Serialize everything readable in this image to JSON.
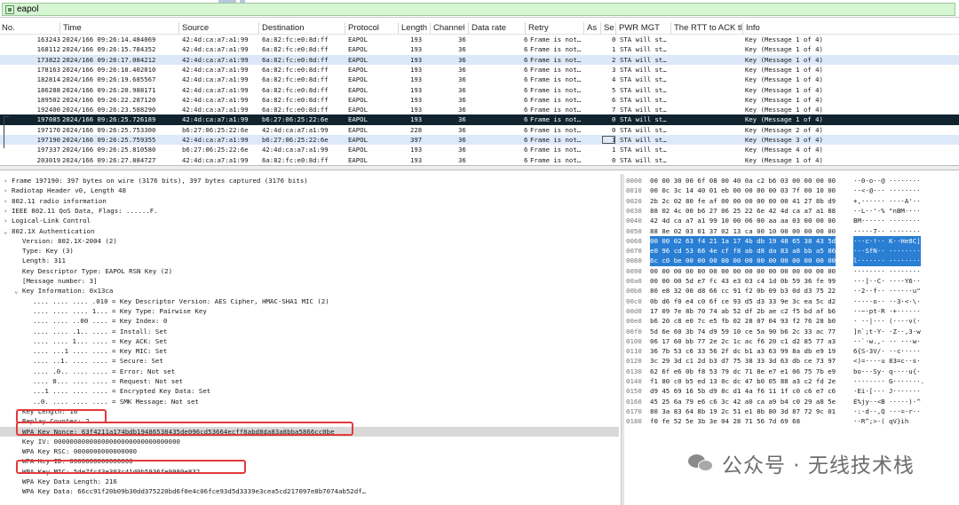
{
  "filter": {
    "value": "eapol"
  },
  "columns": [
    "No.",
    "Time",
    "Source",
    "Destination",
    "Protocol",
    "Length",
    "Channel",
    "Data rate",
    "Retry",
    "As",
    "Se",
    "PWR MGT",
    "The RTT to ACK tl",
    "Info"
  ],
  "packets": [
    {
      "no": "163243",
      "time": "2024/166 09:26:14.484069",
      "src": "42:4d:ca:a7:a1:99",
      "dst": "6a:82:fc:e0:8d:ff",
      "proto": "EAPOL",
      "len": "193",
      "ch": "36",
      "rate": "6",
      "retry": "Frame is not…",
      "se": "0",
      "pwr": "STA will st…",
      "info": "Key (Message 1 of 4)",
      "style": ""
    },
    {
      "no": "168112",
      "time": "2024/166 09:26:15.784352",
      "src": "42:4d:ca:a7:a1:99",
      "dst": "6a:82:fc:e0:8d:ff",
      "proto": "EAPOL",
      "len": "193",
      "ch": "36",
      "rate": "6",
      "retry": "Frame is not…",
      "se": "1",
      "pwr": "STA will st…",
      "info": "Key (Message 1 of 4)",
      "style": ""
    },
    {
      "no": "173822",
      "time": "2024/166 09:26:17.084212",
      "src": "42:4d:ca:a7:a1:99",
      "dst": "6a:82:fc:e0:8d:ff",
      "proto": "EAPOL",
      "len": "193",
      "ch": "36",
      "rate": "6",
      "retry": "Frame is not…",
      "se": "2",
      "pwr": "STA will st…",
      "info": "Key (Message 1 of 4)",
      "style": "alt"
    },
    {
      "no": "178163",
      "time": "2024/166 09:26:18.402010",
      "src": "42:4d:ca:a7:a1:99",
      "dst": "6a:82:fc:e0:8d:ff",
      "proto": "EAPOL",
      "len": "193",
      "ch": "36",
      "rate": "6",
      "retry": "Frame is not…",
      "se": "3",
      "pwr": "STA will st…",
      "info": "Key (Message 1 of 4)",
      "style": ""
    },
    {
      "no": "182814",
      "time": "2024/166 09:26:19.685567",
      "src": "42:4d:ca:a7:a1:99",
      "dst": "6a:82:fc:e0:8d:ff",
      "proto": "EAPOL",
      "len": "193",
      "ch": "36",
      "rate": "6",
      "retry": "Frame is not…",
      "se": "4",
      "pwr": "STA will st…",
      "info": "Key (Message 1 of 4)",
      "style": ""
    },
    {
      "no": "186288",
      "time": "2024/166 09:26:20.988171",
      "src": "42:4d:ca:a7:a1:99",
      "dst": "6a:82:fc:e0:8d:ff",
      "proto": "EAPOL",
      "len": "193",
      "ch": "36",
      "rate": "6",
      "retry": "Frame is not…",
      "se": "5",
      "pwr": "STA will st…",
      "info": "Key (Message 1 of 4)",
      "style": ""
    },
    {
      "no": "189502",
      "time": "2024/166 09:26:22.287120",
      "src": "42:4d:ca:a7:a1:99",
      "dst": "6a:82:fc:e0:8d:ff",
      "proto": "EAPOL",
      "len": "193",
      "ch": "36",
      "rate": "6",
      "retry": "Frame is not…",
      "se": "6",
      "pwr": "STA will st…",
      "info": "Key (Message 1 of 4)",
      "style": ""
    },
    {
      "no": "192400",
      "time": "2024/166 09:26:23.588290",
      "src": "42:4d:ca:a7:a1:99",
      "dst": "6a:82:fc:e0:8d:ff",
      "proto": "EAPOL",
      "len": "193",
      "ch": "36",
      "rate": "6",
      "retry": "Frame is not…",
      "se": "7",
      "pwr": "STA will st…",
      "info": "Key (Message 1 of 4)",
      "style": ""
    },
    {
      "no": "197085",
      "time": "2024/166 09:26:25.726189",
      "src": "42:4d:ca:a7:a1:99",
      "dst": "b6:27:06:25:22:6e",
      "proto": "EAPOL",
      "len": "193",
      "ch": "36",
      "rate": "6",
      "retry": "Frame is not…",
      "se": "0",
      "pwr": "STA will st…",
      "info": "Key (Message 1 of 4)",
      "style": "sel"
    },
    {
      "no": "197170",
      "time": "2024/166 09:26:25.753300",
      "src": "b6:27:06:25:22:6e",
      "dst": "42:4d:ca:a7:a1:99",
      "proto": "EAPOL",
      "len": "228",
      "ch": "36",
      "rate": "6",
      "retry": "Frame is not…",
      "se": "0",
      "pwr": "STA will st…",
      "info": "Key (Message 2 of 4)",
      "style": ""
    },
    {
      "no": "197190",
      "time": "2024/166 09:26:25.759355",
      "src": "42:4d:ca:a7:a1:99",
      "dst": "b6:27:06:25:22:6e",
      "proto": "EAPOL",
      "len": "397",
      "ch": "36",
      "rate": "6",
      "retry": "Frame is not…",
      "se": "1",
      "pwr": "STA will st…",
      "info": "Key (Message 3 of 4)",
      "style": "grp"
    },
    {
      "no": "197337",
      "time": "2024/166 09:26:25.810580",
      "src": "b6:27:06:25:22:6e",
      "dst": "42:4d:ca:a7:a1:99",
      "proto": "EAPOL",
      "len": "193",
      "ch": "36",
      "rate": "6",
      "retry": "Frame is not…",
      "se": "1",
      "pwr": "STA will st…",
      "info": "Key (Message 4 of 4)",
      "style": ""
    },
    {
      "no": "203019",
      "time": "2024/166 09:26:27.884727",
      "src": "42:4d:ca:a7:a1:99",
      "dst": "6a:82:fc:e0:8d:ff",
      "proto": "EAPOL",
      "len": "193",
      "ch": "36",
      "rate": "6",
      "retry": "Frame is not…",
      "se": "0",
      "pwr": "STA will st…",
      "info": "Key (Message 1 of 4)",
      "style": ""
    }
  ],
  "details": [
    {
      "t": ">",
      "text": "Frame 197190: 397 bytes on wire (3176 bits), 397 bytes captured (3176 bits)",
      "ind": 0
    },
    {
      "t": ">",
      "text": "Radiotap Header v0, Length 48",
      "ind": 0
    },
    {
      "t": ">",
      "text": "802.11 radio information",
      "ind": 0
    },
    {
      "t": ">",
      "text": "IEEE 802.11 QoS Data, Flags: ......F.",
      "ind": 0
    },
    {
      "t": ">",
      "text": "Logical-Link Control",
      "ind": 0
    },
    {
      "t": "v",
      "text": "802.1X Authentication",
      "ind": 0
    },
    {
      "t": "",
      "text": "Version: 802.1X-2004 (2)",
      "ind": 1
    },
    {
      "t": "",
      "text": "Type: Key (3)",
      "ind": 1
    },
    {
      "t": "",
      "text": "Length: 311",
      "ind": 1
    },
    {
      "t": "",
      "text": "Key Descriptor Type: EAPOL RSN Key (2)",
      "ind": 1
    },
    {
      "t": "",
      "text": "[Message number: 3]",
      "ind": 1
    },
    {
      "t": "v",
      "text": "Key Information: 0x13ca",
      "ind": 1
    },
    {
      "t": "",
      "text": ".... .... .... .010 = Key Descriptor Version: AES Cipher, HMAC-SHA1 MIC (2)",
      "ind": 2
    },
    {
      "t": "",
      "text": ".... .... .... 1... = Key Type: Pairwise Key",
      "ind": 2
    },
    {
      "t": "",
      "text": ".... .... ..00 .... = Key Index: 0",
      "ind": 2
    },
    {
      "t": "",
      "text": ".... .... .1.. .... = Install: Set",
      "ind": 2
    },
    {
      "t": "",
      "text": ".... .... 1... .... = Key ACK: Set",
      "ind": 2
    },
    {
      "t": "",
      "text": ".... ...1 .... .... = Key MIC: Set",
      "ind": 2
    },
    {
      "t": "",
      "text": ".... ..1. .... .... = Secure: Set",
      "ind": 2
    },
    {
      "t": "",
      "text": ".... .0.. .... .... = Error: Not set",
      "ind": 2
    },
    {
      "t": "",
      "text": ".... 0... .... .... = Request: Not set",
      "ind": 2
    },
    {
      "t": "",
      "text": "...1 .... .... .... = Encrypted Key Data: Set",
      "ind": 2
    },
    {
      "t": "",
      "text": "..0. .... .... .... = SMK Message: Not set",
      "ind": 2
    },
    {
      "t": "",
      "text": "Key Length: 16",
      "ind": 1
    },
    {
      "t": "",
      "text": "Replay Counter: 2",
      "ind": 1
    },
    {
      "t": "",
      "text": "WPA Key Nonce: 63f4211a174bdb19486538435de096cd53664ecff8abd8da83a8bba5866cc0be",
      "ind": 1,
      "hl": true
    },
    {
      "t": "",
      "text": "Key IV: 00000000000000000000000000000000",
      "ind": 1
    },
    {
      "t": "",
      "text": "WPA Key RSC: 0000000000000000",
      "ind": 1
    },
    {
      "t": "",
      "text": "WPA Key ID: 0000000000000000",
      "ind": 1
    },
    {
      "t": "",
      "text": "WPA Key MIC: 5de7fc43e303c41d0b5936fe9980e832",
      "ind": 1
    },
    {
      "t": "",
      "text": "WPA Key Data Length: 216",
      "ind": 1
    },
    {
      "t": "",
      "text": "WPA Key Data: 66cc91f20b09b30dd375220bd6f0e4c06fce93d5d3339e3cea5cd217097e8b7074ab52df…",
      "ind": 1
    }
  ],
  "hexdump": [
    {
      "off": "0000",
      "hex": "00 00 30 00 6f 08 00 40  0a c2 b6 03 00 00 00 00",
      "asc": "··0·o··@ ········"
    },
    {
      "off": "0010",
      "hex": "00 0c 3c 14 40 01 eb 00  00 00 00 03 7f 00 10 00",
      "asc": "··<·@··· ········"
    },
    {
      "off": "0020",
      "hex": "2b 2c 02 80 fe af 00 00  00 00 00 00 41 27 8b d9",
      "asc": "+,······ ····A'··"
    },
    {
      "off": "0030",
      "hex": "88 02 4c 00 b6 27 06 25  22 6e 42 4d ca a7 a1 88",
      "asc": "··L··'·% \"nBM····"
    },
    {
      "off": "0040",
      "hex": "42 4d ca a7 a1 99 10 00  06 00 aa aa 03 00 00 00",
      "asc": "BM······ ········"
    },
    {
      "off": "0050",
      "hex": "88 8e 02 03 01 37 02 13  ca 00 10 00 00 00 00 00",
      "asc": "·····7·· ········"
    },
    {
      "off": "0060",
      "hex": "00 00 02 63 f4 21 1a 17  4b db 19 48 65 38 43 5d",
      "asc": "···c·!·· K··He8C]",
      "sel": "0060"
    },
    {
      "off": "0070",
      "hex": "e0 96 cd 53 66 4e cf f8  ab d8 da 83 a8 bb a5 86",
      "asc": "···SfN·· ········",
      "sel": "0070"
    },
    {
      "off": "0080",
      "hex": "6c c0 be 00 00 00 00 00  00 00 00 00 00 00 00 00",
      "asc": "l·······  ········",
      "sel": "0080"
    },
    {
      "off": "0090",
      "hex": "00 00 00 00 00 00 00 00  00 00 00 00 00 00 00 00",
      "asc": "········ ········"
    },
    {
      "off": "00a0",
      "hex": "00 00 00 5d e7 fc 43 e3  03 c4 1d 0b 59 36 fe 99",
      "asc": "···]··C· ····Y6··"
    },
    {
      "off": "00b0",
      "hex": "80 e8 32 00 d8 66 cc 91  f2 0b 09 b3 0d d3 75 22",
      "asc": "··2··f·· ······u\""
    },
    {
      "off": "00c0",
      "hex": "0b d6 f0 e4 c0 6f ce 93  d5 d3 33 9e 3c ea 5c d2",
      "asc": "·····o·· ··3·<·\\·"
    },
    {
      "off": "00d0",
      "hex": "17 09 7e 8b 70 74 ab 52  df 2b ae c2 f5 bd af b6",
      "asc": "··~·pt·R ·+······"
    },
    {
      "off": "00e0",
      "hex": "b6 20 c8 e0 7c e5 fb 02  28 07 04 93 f2 76 28 b0",
      "asc": "· ··|··· (····v(·"
    },
    {
      "off": "00f0",
      "hex": "5d 6e 60 3b 74 d9 59 10  ce 5a 90 b6 2c 33 ac 77",
      "asc": "]n`;t·Y· ·Z··,3·w"
    },
    {
      "off": "0100",
      "hex": "06 17 60 bb 77 2e 2c 1c  ac f6 20 c1 d2 85 77 a3",
      "asc": "··`·w.,· ·· ···w·"
    },
    {
      "off": "0110",
      "hex": "36 7b 53 c6 33 56 2f dc  b1 a3 63 99 8a db e9 19",
      "asc": "6{S·3V/· ··c·····"
    },
    {
      "off": "0120",
      "hex": "3c 29 3d c1 2d b3 d7 75  38 33 3d 63 db ce 73 97",
      "asc": "<)=·-··u 83=c··s·"
    },
    {
      "off": "0130",
      "hex": "62 6f e6 0b f8 53 79 dc  71 8e e7 e1 06 75 7b e9",
      "asc": "bo···Sy· q····u{·"
    },
    {
      "off": "0140",
      "hex": "f1 80 c0 b5 ed 13 0c dc  47 b0 05 88 a3 c2 fd 2e",
      "asc": "········ G·······."
    },
    {
      "off": "0150",
      "hex": "d9 45 69 16 5b d9 8c d1  4a f6 11 1f c0 c6 e7 c6",
      "asc": "·Ei·[··· J·······"
    },
    {
      "off": "0160",
      "hex": "45 25 6a 79 e6 c6 3c 42  a0 ca a9 b4 c0 29 a8 5e",
      "asc": "E%jy··<B ·····)·^"
    },
    {
      "off": "0170",
      "hex": "80 3a 83 64 8b 19 2c 51  e1 8b 80 3d 87 72 9c 01",
      "asc": "·:·d··,Q ···=·r··"
    },
    {
      "off": "0180",
      "hex": "f0 fe 52 5e 3b 3e 04 28  71 56 7d 69 68",
      "asc": "··R^;>·( qV}ih"
    }
  ],
  "watermark": {
    "text": "公众号 · 无线技术栈"
  }
}
